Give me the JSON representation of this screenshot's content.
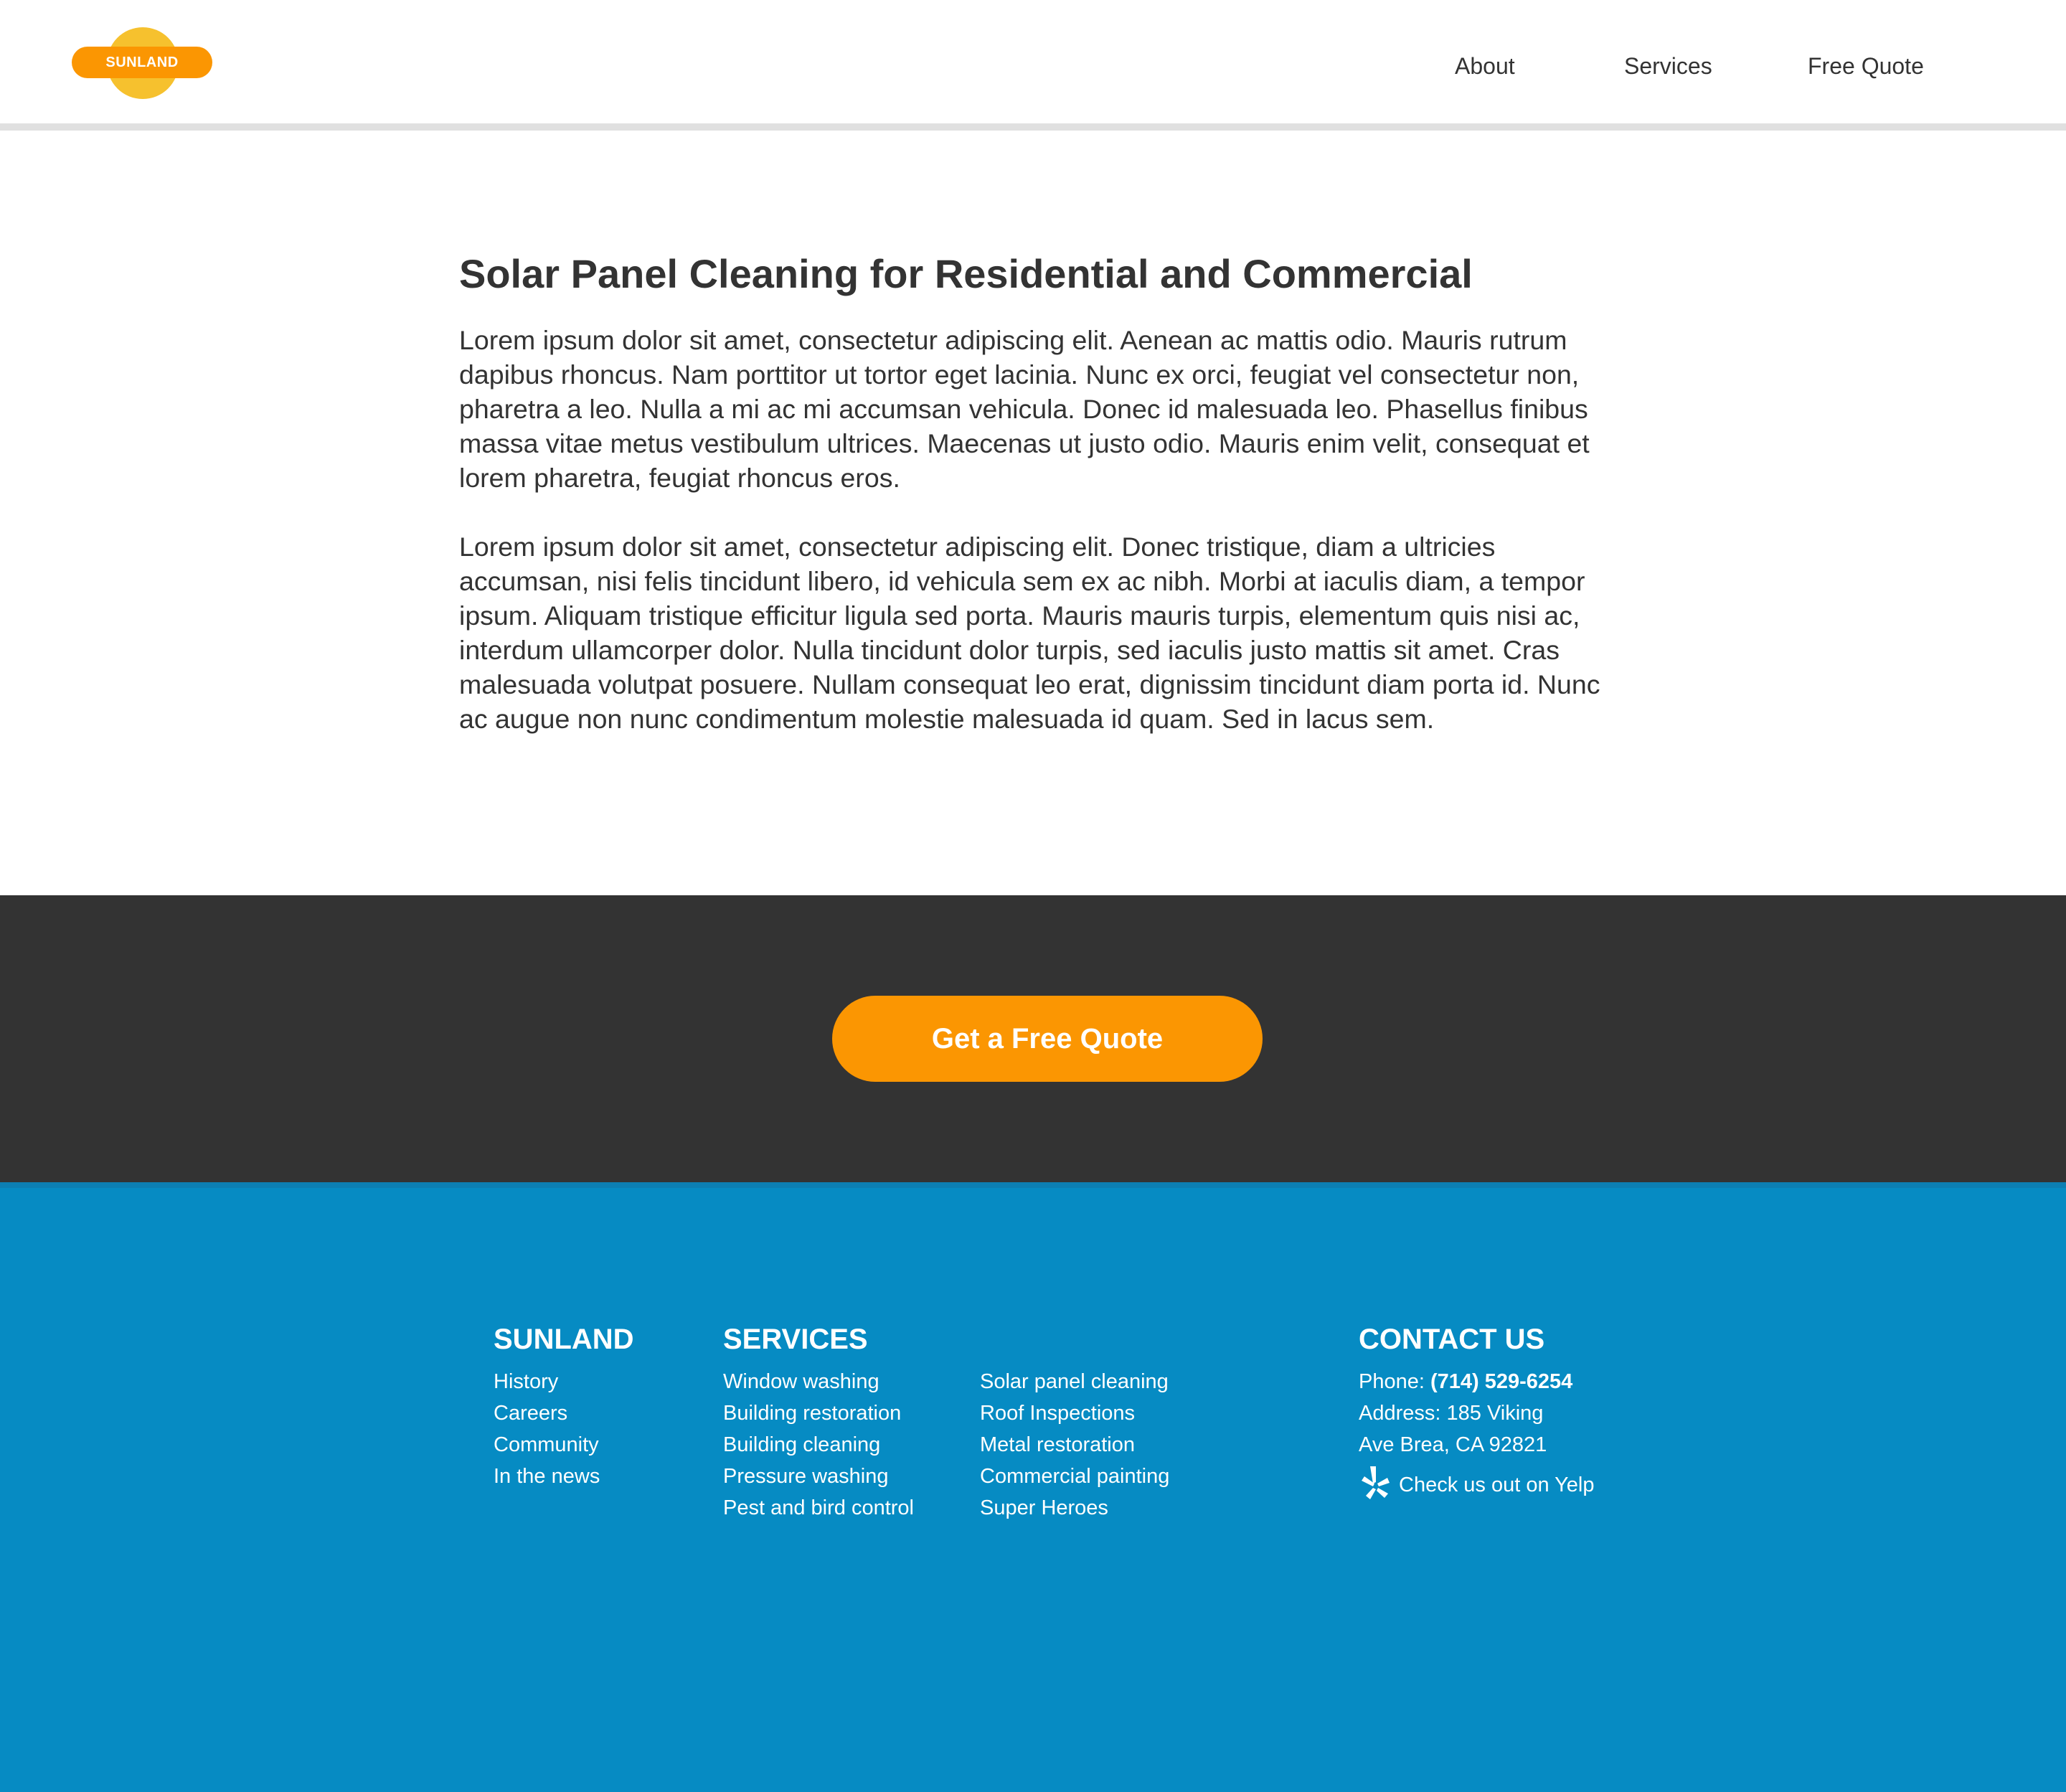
{
  "brand": {
    "logo_text": "SUNLAND"
  },
  "nav": {
    "items": [
      "About",
      "Services",
      "Free Quote"
    ]
  },
  "main": {
    "title": "Solar Panel Cleaning for Residential and Commercial",
    "paragraphs": [
      "Lorem ipsum dolor sit amet, consectetur adipiscing elit. Aenean ac mattis odio. Mauris rutrum dapibus rhoncus. Nam porttitor ut tortor eget lacinia. Nunc ex orci, feugiat vel consectetur non, pharetra a leo. Nulla a mi ac mi accumsan vehicula. Donec id malesuada leo. Phasellus finibus massa vitae metus vestibulum ultrices. Maecenas ut justo odio. Mauris enim velit, consequat et lorem pharetra, feugiat rhoncus eros.",
      "Lorem ipsum dolor sit amet, consectetur adipiscing elit. Donec tristique, diam a ultricies accumsan, nisi felis tincidunt libero, id vehicula sem ex ac nibh. Morbi at iaculis diam, a tempor ipsum. Aliquam tristique efficitur ligula sed porta. Mauris mauris turpis, elementum quis nisi ac, interdum ullamcorper dolor. Nulla tincidunt dolor turpis, sed iaculis justo mattis sit amet. Cras malesuada volutpat posuere. Nullam consequat leo erat, dignissim tincidunt diam porta id. Nunc ac augue non nunc condimentum molestie malesuada id quam. Sed in lacus sem."
    ]
  },
  "cta": {
    "label": "Get a Free Quote"
  },
  "footer": {
    "company": {
      "heading": "SUNLAND",
      "links": [
        "History",
        "Careers",
        "Community",
        "In the news"
      ]
    },
    "services": {
      "heading": "SERVICES",
      "col1": [
        "Window washing",
        "Building restoration",
        "Building cleaning",
        "Pressure washing",
        "Pest and bird control"
      ],
      "col2": [
        "Solar panel cleaning",
        "Roof Inspections",
        "Metal restoration",
        "Commercial painting",
        "Super Heroes"
      ]
    },
    "contact": {
      "heading": "CONTACT US",
      "phone_label": "Phone:",
      "phone": "(714) 529-6254",
      "address_line1": "Address: 185 Viking",
      "address_line2": "Ave Brea, CA 92821",
      "yelp_label": "Check us out on Yelp",
      "yelp_icon": "yelp-icon"
    }
  },
  "colors": {
    "accent_orange": "#fb9602",
    "sun_yellow": "#f6c12e",
    "cta_band": "#333333",
    "footer_blue": "#068bc3",
    "text_dark": "#333333"
  }
}
